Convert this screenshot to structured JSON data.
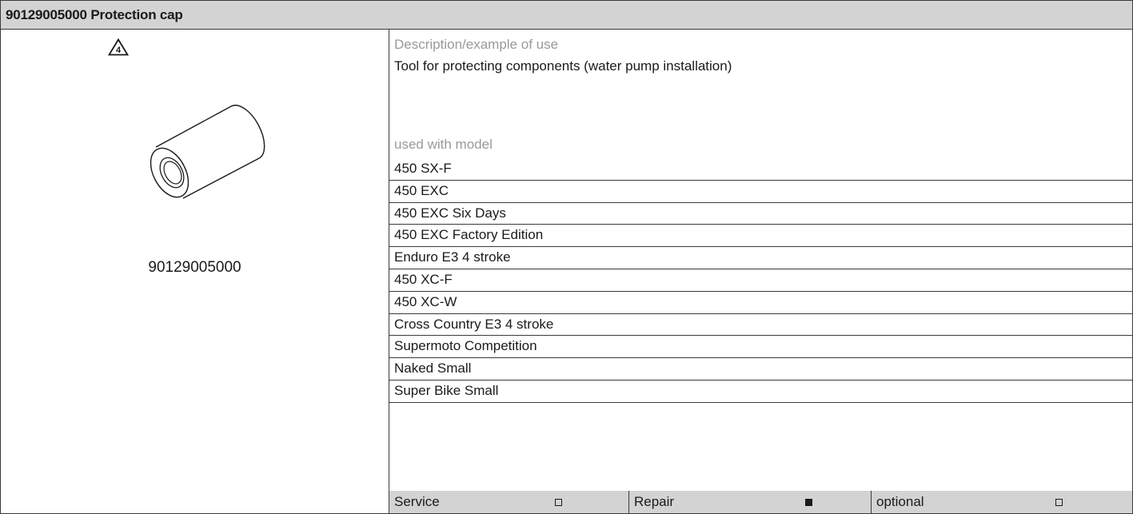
{
  "header": {
    "title": "90129005000 Protection cap"
  },
  "tool": {
    "warning_number": "4",
    "part_number": "90129005000"
  },
  "description": {
    "label": "Description/example of use",
    "text": "Tool for protecting components (water pump installation)"
  },
  "models": {
    "label": "used with model",
    "items": [
      "450 SX-F",
      "450 EXC",
      "450 EXC Six Days",
      "450 EXC Factory Edition",
      "Enduro E3 4 stroke",
      "450 XC-F",
      "450 XC-W",
      "Cross Country E3 4 stroke",
      "Supermoto Competition",
      "Naked Small",
      "Super Bike Small"
    ]
  },
  "usage": [
    {
      "label": "Service",
      "checked": false
    },
    {
      "label": "Repair",
      "checked": true
    },
    {
      "label": "optional",
      "checked": false
    }
  ]
}
